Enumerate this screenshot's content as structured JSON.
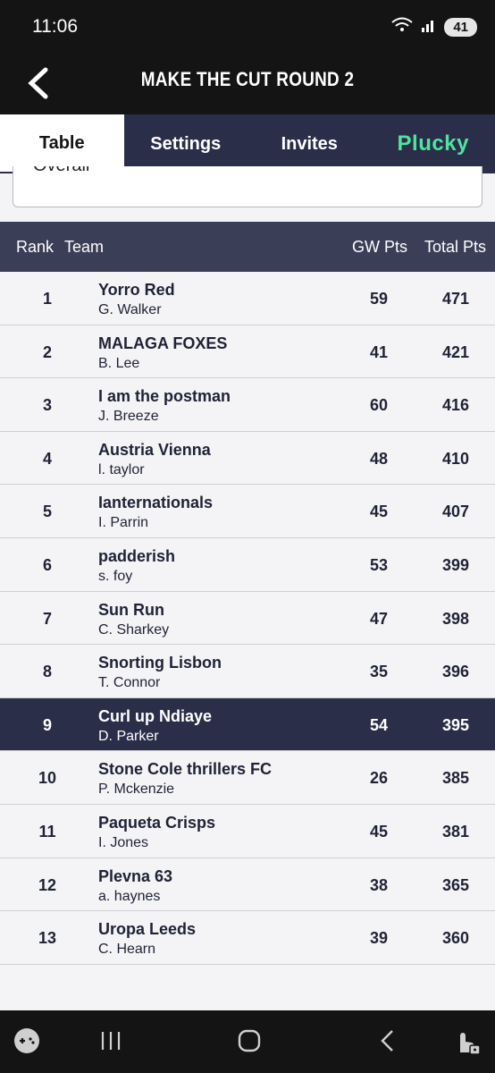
{
  "status_bar": {
    "time": "11:06",
    "battery": "41"
  },
  "header": {
    "title": "MAKE THE CUT ROUND 2"
  },
  "tabs": [
    {
      "label": "Table"
    },
    {
      "label": "Settings"
    },
    {
      "label": "Invites"
    },
    {
      "label": "Plucky"
    }
  ],
  "filter": {
    "value": "Overall"
  },
  "table": {
    "headers": {
      "rank": "Rank",
      "team": "Team",
      "gw": "GW Pts",
      "total": "Total Pts"
    },
    "rows": [
      {
        "rank": "1",
        "team": "Yorro Red",
        "manager": "G. Walker",
        "gw": "59",
        "total": "471"
      },
      {
        "rank": "2",
        "team": "MALAGA FOXES",
        "manager": "B. Lee",
        "gw": "41",
        "total": "421"
      },
      {
        "rank": "3",
        "team": "I am the postman",
        "manager": "J. Breeze",
        "gw": "60",
        "total": "416"
      },
      {
        "rank": "4",
        "team": "Austria Vienna",
        "manager": "l. taylor",
        "gw": "48",
        "total": "410"
      },
      {
        "rank": "5",
        "team": "Ianternationals",
        "manager": "I. Parrin",
        "gw": "45",
        "total": "407"
      },
      {
        "rank": "6",
        "team": "padderish",
        "manager": "s. foy",
        "gw": "53",
        "total": "399"
      },
      {
        "rank": "7",
        "team": "Sun Run",
        "manager": "C. Sharkey",
        "gw": "47",
        "total": "398"
      },
      {
        "rank": "8",
        "team": "Snorting Lisbon",
        "manager": "T. Connor",
        "gw": "35",
        "total": "396"
      },
      {
        "rank": "9",
        "team": "Curl up Ndiaye",
        "manager": "D. Parker",
        "gw": "54",
        "total": "395",
        "highlight": true
      },
      {
        "rank": "10",
        "team": "Stone Cole thrillers FC",
        "manager": "P. Mckenzie",
        "gw": "26",
        "total": "385"
      },
      {
        "rank": "11",
        "team": "Paqueta Crisps",
        "manager": "I. Jones",
        "gw": "45",
        "total": "381"
      },
      {
        "rank": "12",
        "team": "Plevna 63",
        "manager": "a. haynes",
        "gw": "38",
        "total": "365"
      },
      {
        "rank": "13",
        "team": "Uropa Leeds",
        "manager": "C. Hearn",
        "gw": "39",
        "total": "360"
      }
    ]
  },
  "colors": {
    "header_bg": "#141414",
    "tab_bar": "#2b2e49",
    "table_header": "#3b3e57",
    "highlight_row": "#2b2e49",
    "brand_green": "#4fe3a0"
  },
  "icons": {
    "back": "back-arrow-icon",
    "wifi": "wifi-icon",
    "signal": "signal-icon",
    "game": "game-launcher-icon",
    "recents": "recents-icon",
    "home": "home-icon",
    "nav_back": "nav-back-icon",
    "accessibility": "touch-lock-icon"
  }
}
